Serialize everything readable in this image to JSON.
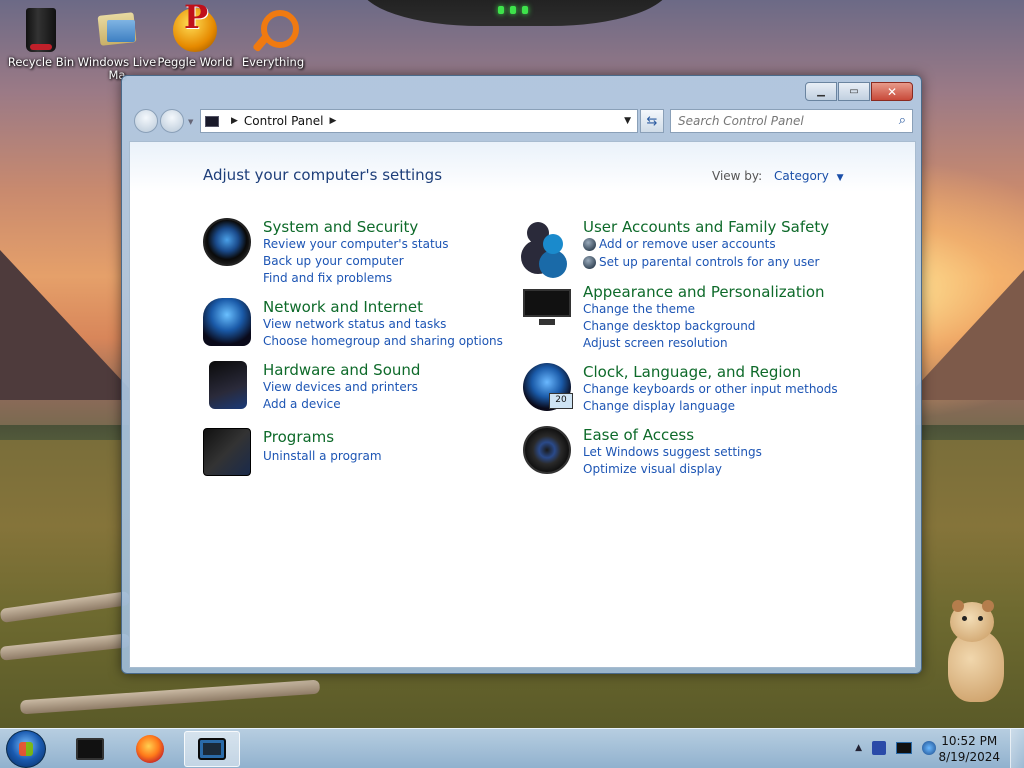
{
  "desktop": {
    "icons": [
      {
        "label": "Recycle Bin"
      },
      {
        "label": "Windows Live Ma"
      },
      {
        "label": "Peggle World"
      },
      {
        "label": "Everything"
      }
    ]
  },
  "window": {
    "address": {
      "crumb": "Control Panel"
    },
    "search_placeholder": "Search Control Panel",
    "heading": "Adjust your computer's settings",
    "view_by_label": "View by:",
    "view_by_value": "Category",
    "categories": [
      {
        "icon": "shield-icon",
        "title": "System and Security",
        "links": [
          "Review your computer's status",
          "Back up your computer",
          "Find and fix problems"
        ]
      },
      {
        "icon": "network-globe-icon",
        "title": "Network and Internet",
        "links": [
          "View network status and tasks",
          "Choose homegroup and sharing options"
        ]
      },
      {
        "icon": "printer-icon",
        "title": "Hardware and Sound",
        "links": [
          "View devices and printers",
          "Add a device"
        ]
      },
      {
        "icon": "programs-icon",
        "title": "Programs",
        "links": [
          "Uninstall a program"
        ]
      },
      {
        "icon": "users-icon",
        "title": "User Accounts and Family Safety",
        "links": [
          "Add or remove user accounts",
          "Set up parental controls for any user"
        ]
      },
      {
        "icon": "monitor-icon",
        "title": "Appearance and Personalization",
        "links": [
          "Change the theme",
          "Change desktop background",
          "Adjust screen resolution"
        ]
      },
      {
        "icon": "globe-clock-icon",
        "title": "Clock, Language, and Region",
        "links": [
          "Change keyboards or other input methods",
          "Change display language"
        ]
      },
      {
        "icon": "ease-of-access-icon",
        "title": "Ease of Access",
        "links": [
          "Let Windows suggest settings",
          "Optimize visual display"
        ]
      }
    ]
  },
  "taskbar": {
    "time": "10:52 PM",
    "date": "8/19/2024"
  },
  "colors": {
    "category_title": "#0e6a2a",
    "link": "#1d55b4",
    "heading": "#1e3f7a"
  }
}
